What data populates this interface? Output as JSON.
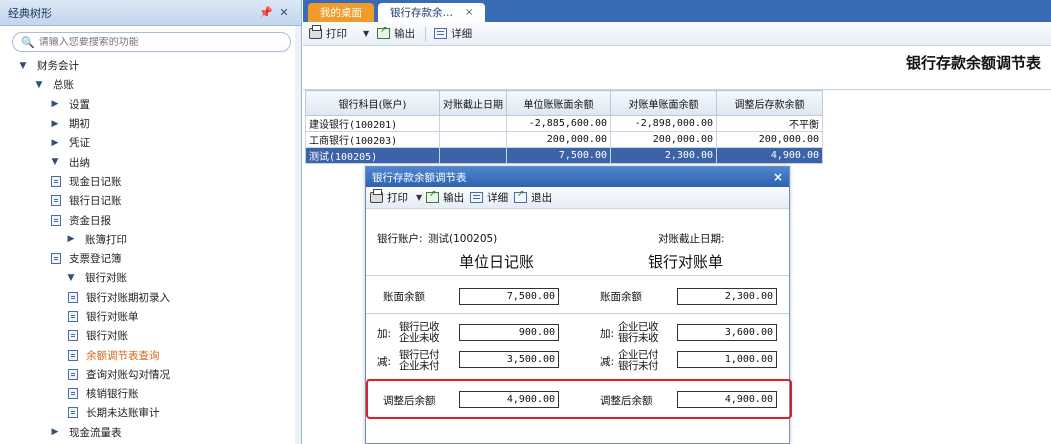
{
  "sidebar": {
    "title": "经典树形",
    "search_placeholder": "请输入您要搜索的功能",
    "tree": [
      {
        "label": "财务会计",
        "level": 0,
        "type": "folder",
        "expanded": true
      },
      {
        "label": "总账",
        "level": 1,
        "type": "folder",
        "expanded": true
      },
      {
        "label": "设置",
        "level": 2,
        "type": "folder",
        "expanded": false
      },
      {
        "label": "期初",
        "level": 2,
        "type": "folder",
        "expanded": false
      },
      {
        "label": "凭证",
        "level": 2,
        "type": "folder",
        "expanded": false
      },
      {
        "label": "出纳",
        "level": 2,
        "type": "folder",
        "expanded": true
      },
      {
        "label": "现金日记账",
        "level": 3,
        "type": "leaf"
      },
      {
        "label": "银行日记账",
        "level": 3,
        "type": "leaf"
      },
      {
        "label": "资金日报",
        "level": 3,
        "type": "leaf"
      },
      {
        "label": "账簿打印",
        "level": 3,
        "type": "folder",
        "expanded": false
      },
      {
        "label": "支票登记簿",
        "level": 3,
        "type": "leaf"
      },
      {
        "label": "银行对账",
        "level": 3,
        "type": "folder",
        "expanded": true
      },
      {
        "label": "银行对账期初录入",
        "level": 4,
        "type": "leaf"
      },
      {
        "label": "银行对账单",
        "level": 4,
        "type": "leaf"
      },
      {
        "label": "银行对账",
        "level": 4,
        "type": "leaf"
      },
      {
        "label": "余额调节表查询",
        "level": 4,
        "type": "leaf",
        "active": true
      },
      {
        "label": "查询对账勾对情况",
        "level": 4,
        "type": "leaf"
      },
      {
        "label": "核销银行账",
        "level": 4,
        "type": "leaf"
      },
      {
        "label": "长期未达账审计",
        "level": 4,
        "type": "leaf"
      },
      {
        "label": "现金流量表",
        "level": 2,
        "type": "folder",
        "expanded": false
      }
    ]
  },
  "tabs": [
    {
      "label": "我的桌面",
      "style": "orange"
    },
    {
      "label": "银行存款余…",
      "style": "white",
      "close": "×"
    }
  ],
  "toolbar": {
    "print": "打印",
    "export": "输出",
    "detail": "详细"
  },
  "report": {
    "title": "银行存款余额调节表",
    "columns": [
      "银行科目(账户)",
      "对账截止日期",
      "单位账账面余额",
      "对账单账面余额",
      "调整后存款余额"
    ],
    "rows": [
      [
        "建设银行(100201)",
        "",
        "-2,885,600.00",
        "-2,898,000.00",
        "不平衡"
      ],
      [
        "工商银行(100203)",
        "",
        "200,000.00",
        "200,000.00",
        "200,000.00"
      ],
      [
        "测试(100205)",
        "",
        "7,500.00",
        "2,300.00",
        "4,900.00"
      ]
    ],
    "selected_row": 2
  },
  "dialog": {
    "title": "银行存款余额调节表",
    "close": "×",
    "tools": {
      "print": "打印",
      "export": "输出",
      "detail": "详细",
      "exit": "退出"
    },
    "account_label": "银行账户:",
    "account_value": "测试(100205)",
    "cutoff_label": "对账截止日期:",
    "left_heading": "单位日记账",
    "right_heading": "银行对账单",
    "left": {
      "balance_label": "账面余额",
      "balance": "7,500.00",
      "add_prefix": "加:",
      "add_line1": "银行已收",
      "add_line2": "企业未收",
      "add_value": "900.00",
      "sub_prefix": "减:",
      "sub_line1": "银行已付",
      "sub_line2": "企业未付",
      "sub_value": "3,500.00",
      "adjusted_label": "调整后余额",
      "adjusted": "4,900.00"
    },
    "right": {
      "balance_label": "账面余额",
      "balance": "2,300.00",
      "add_prefix": "加:",
      "add_line1": "企业已收",
      "add_line2": "银行未收",
      "add_value": "3,600.00",
      "sub_prefix": "减:",
      "sub_line1": "企业已付",
      "sub_line2": "银行未付",
      "sub_value": "1,000.00",
      "adjusted_label": "调整后余额",
      "adjusted": "4,900.00"
    },
    "highlight_color": "#e02020"
  }
}
